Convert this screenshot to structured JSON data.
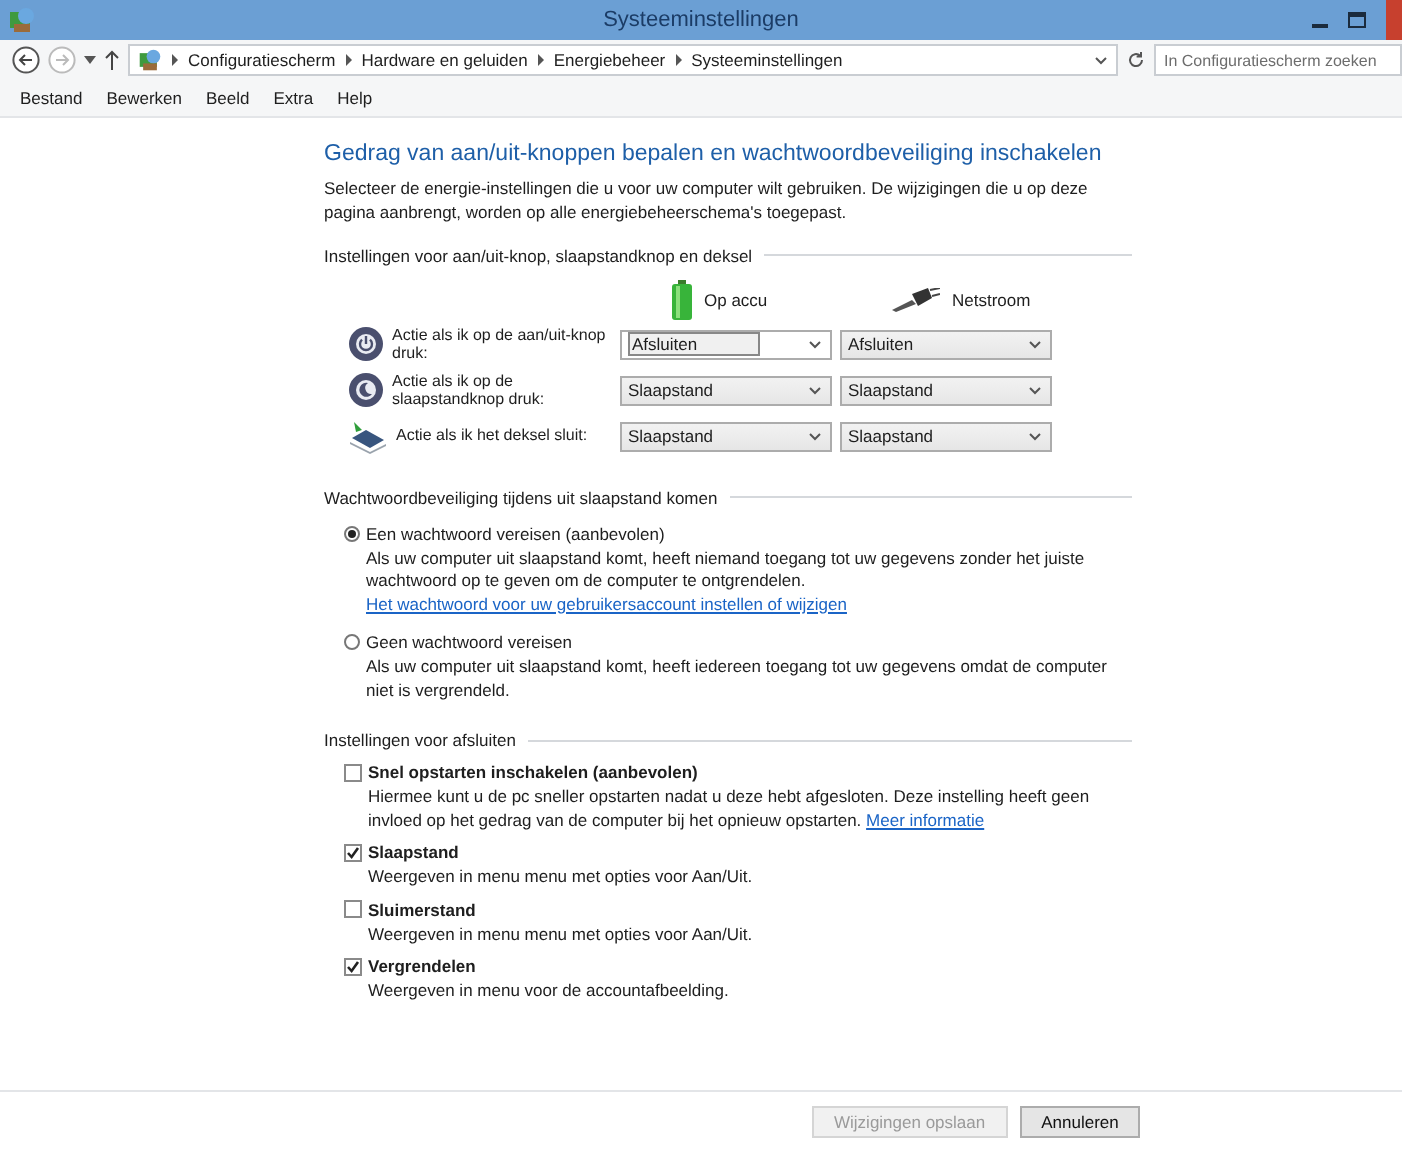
{
  "window": {
    "title": "Systeeminstellingen"
  },
  "nav": {
    "breadcrumb": [
      "Configuratiescherm",
      "Hardware en geluiden",
      "Energiebeheer",
      "Systeeminstellingen"
    ],
    "search": {
      "placeholder": "In Configuratiescherm zoeken"
    }
  },
  "menu": [
    "Bestand",
    "Bewerken",
    "Beeld",
    "Extra",
    "Help"
  ],
  "heading": "Gedrag van aan/uit-knoppen bepalen en wachtwoordbeveiliging inschakelen",
  "intro": "Selecteer de energie-instellingen die u voor uw computer wilt gebruiken. De wijzigingen die u op deze pagina aanbrengt, worden op alle energiebeheerschema's toegepast.",
  "power_buttons": {
    "title": "Instellingen voor aan/uit-knop, slaapstandknop en deksel",
    "columns": [
      {
        "kind": "battery",
        "label": "Op accu"
      },
      {
        "kind": "plug",
        "label": "Netstroom"
      }
    ],
    "rows": [
      {
        "kind": "power",
        "label": "Actie als ik op de aan/uit-knop druk:",
        "on_battery": "Afsluiten",
        "plugged_in": "Afsluiten",
        "focused": true
      },
      {
        "kind": "sleep",
        "label": "Actie als ik op de slaapstandknop druk:",
        "on_battery": "Slaapstand",
        "plugged_in": "Slaapstand",
        "focused": false
      },
      {
        "kind": "lid",
        "label": "Actie als ik het deksel sluit:",
        "on_battery": "Slaapstand",
        "plugged_in": "Slaapstand",
        "focused": false
      }
    ]
  },
  "password": {
    "title": "Wachtwoordbeveiliging tijdens uit slaapstand komen",
    "options": [
      {
        "label": "Een wachtwoord vereisen (aanbevolen)",
        "description": "Als uw computer uit slaapstand komt, heeft niemand toegang tot uw gegevens zonder het juiste wachtwoord op te geven om de computer te ontgrendelen.",
        "link": "Het wachtwoord voor uw gebruikersaccount instellen of wijzigen",
        "selected": true
      },
      {
        "label": "Geen wachtwoord vereisen",
        "description": "Als uw computer uit slaapstand komt, heeft iedereen toegang tot uw gegevens omdat de computer niet is vergrendeld.",
        "selected": false
      }
    ]
  },
  "shutdown": {
    "title": "Instellingen voor afsluiten",
    "options": [
      {
        "label": "Snel opstarten inschakelen (aanbevolen)",
        "description": "Hiermee kunt u de pc sneller opstarten nadat u deze hebt afgesloten. Deze instelling heeft geen invloed op het gedrag van de computer bij het opnieuw opstarten.",
        "link": "Meer informatie",
        "checked": false
      },
      {
        "label": "Slaapstand",
        "description": "Weergeven in menu menu met opties voor Aan/Uit.",
        "checked": true
      },
      {
        "label": "Sluimerstand",
        "description": "Weergeven in menu menu met opties voor Aan/Uit.",
        "checked": false
      },
      {
        "label": "Vergrendelen",
        "description": "Weergeven in menu voor de accountafbeelding.",
        "checked": true
      }
    ]
  },
  "buttons": [
    {
      "label": "Wijzigingen opslaan",
      "disabled": true
    },
    {
      "label": "Annuleren",
      "disabled": false
    }
  ]
}
